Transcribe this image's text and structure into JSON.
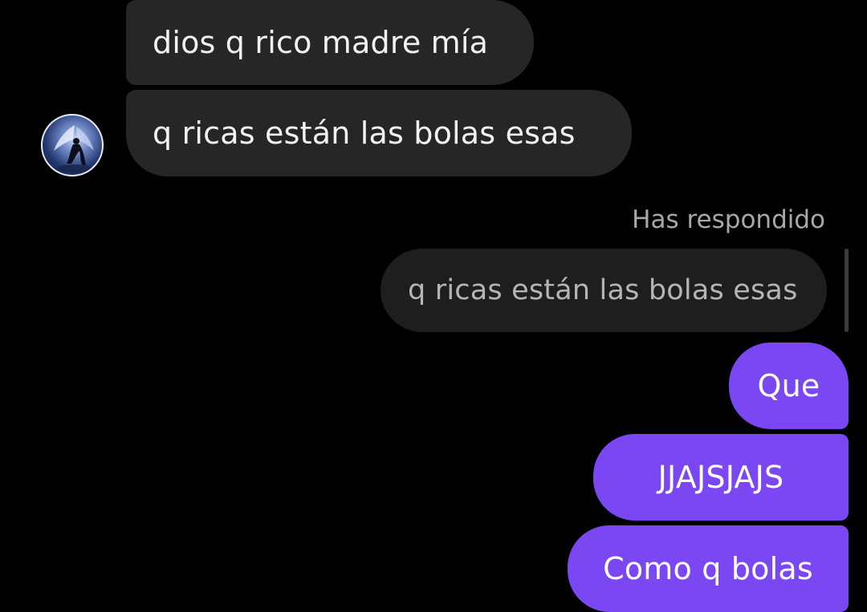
{
  "conversation": {
    "incoming_messages": [
      {
        "text": "dios q rico madre mía"
      },
      {
        "text": "q ricas están las bolas esas"
      }
    ],
    "reply_context": {
      "label": "Has respondido",
      "quoted_text": "q ricas están las bolas esas"
    },
    "outgoing_messages": [
      {
        "text": "Que"
      },
      {
        "text": "JJAJSJAJS"
      },
      {
        "text": "Como q bolas"
      }
    ]
  },
  "colors": {
    "background": "#000000",
    "incoming_bubble": "#262626",
    "quoted_bubble": "#1e1e1e",
    "outgoing_bubble": "#7a47f3",
    "secondary_text": "#a8a8a8"
  },
  "icons": {
    "contact_avatar": "angel-avatar"
  }
}
